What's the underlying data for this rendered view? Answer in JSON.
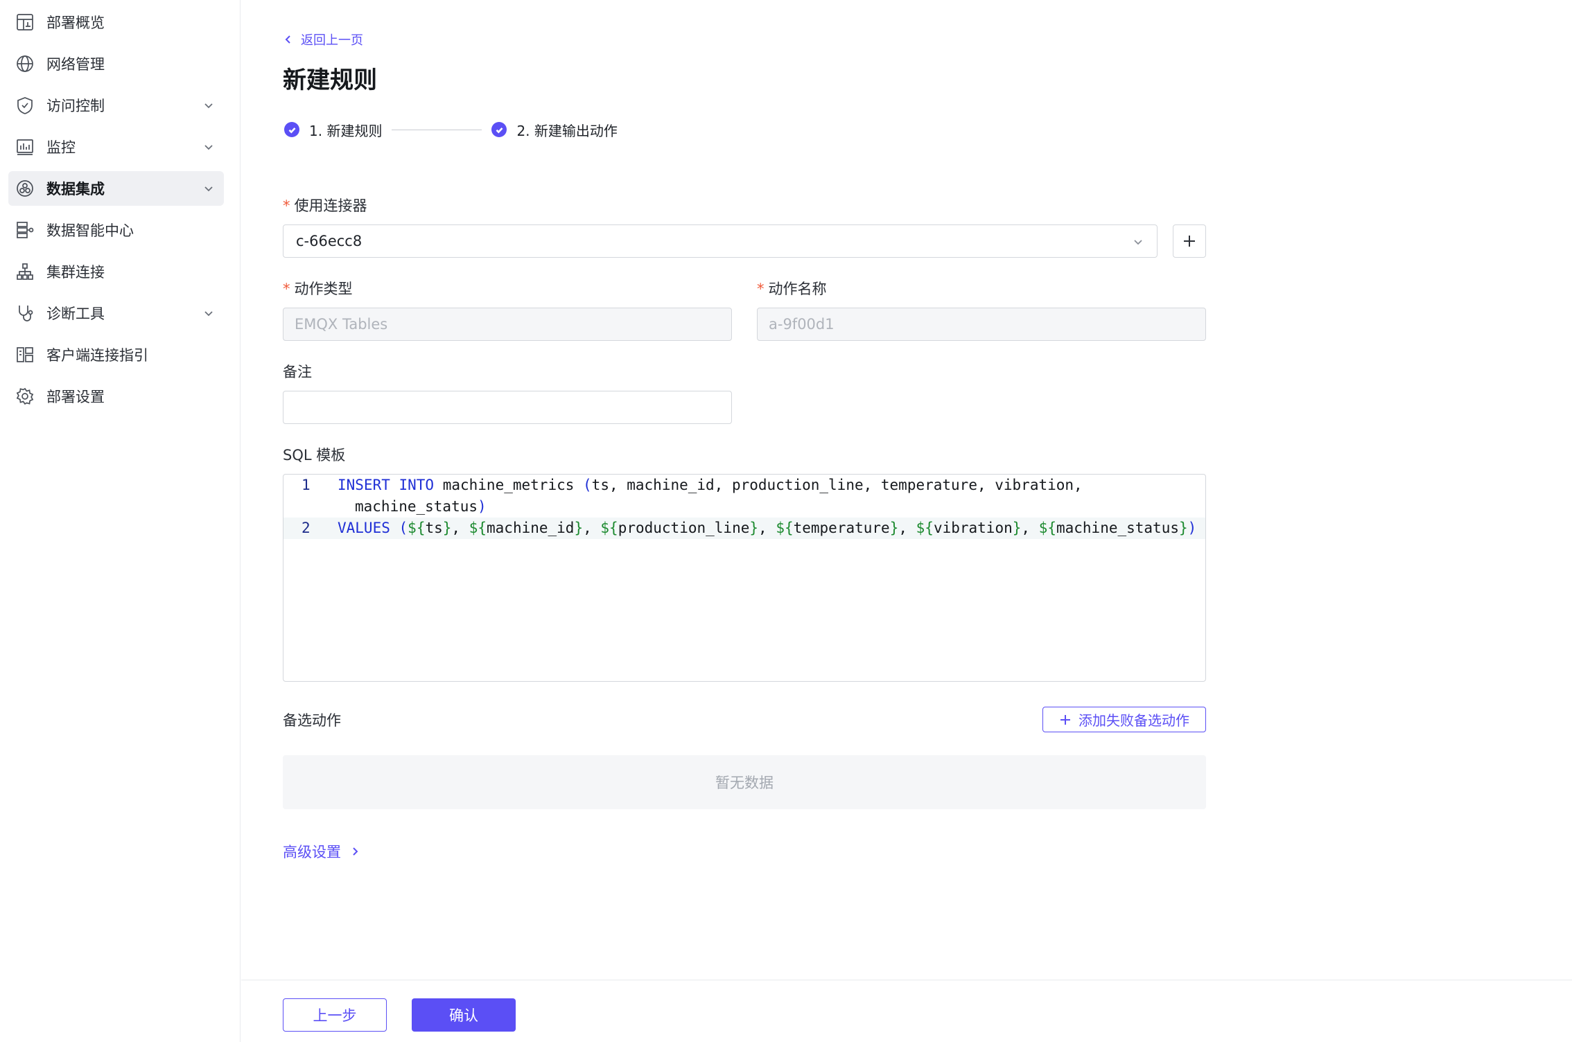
{
  "sidebar": {
    "items": [
      {
        "label": "部署概览",
        "icon": "dashboard-icon",
        "expandable": false
      },
      {
        "label": "网络管理",
        "icon": "globe-icon",
        "expandable": false
      },
      {
        "label": "访问控制",
        "icon": "shield-icon",
        "expandable": true
      },
      {
        "label": "监控",
        "icon": "chart-icon",
        "expandable": true
      },
      {
        "label": "数据集成",
        "icon": "integration-icon",
        "expandable": true,
        "active": true
      },
      {
        "label": "数据智能中心",
        "icon": "data-center-icon",
        "expandable": false
      },
      {
        "label": "集群连接",
        "icon": "cluster-icon",
        "expandable": false
      },
      {
        "label": "诊断工具",
        "icon": "stethoscope-icon",
        "expandable": true
      },
      {
        "label": "客户端连接指引",
        "icon": "client-guide-icon",
        "expandable": false
      },
      {
        "label": "部署设置",
        "icon": "gear-icon",
        "expandable": false
      }
    ]
  },
  "header": {
    "back_label": "返回上一页",
    "title": "新建规则"
  },
  "steps": [
    {
      "label": "1. 新建规则",
      "done": true
    },
    {
      "label": "2. 新建输出动作",
      "done": true
    }
  ],
  "form": {
    "connector_label": "使用连接器",
    "connector_value": "c-66ecc8",
    "action_type_label": "动作类型",
    "action_type_placeholder": "EMQX Tables",
    "action_name_label": "动作名称",
    "action_name_placeholder": "a-9f00d1",
    "note_label": "备注",
    "note_value": "",
    "sql_label": "SQL 模板"
  },
  "sql": {
    "line1_num": "1",
    "line2_num": "2",
    "l1_kw": "INSERT INTO",
    "l1_table": " machine_metrics ",
    "l1_open": "(",
    "l1_cols": "ts, machine_id, production_line, temperature, vibration,",
    "l1_wrap": "machine_status",
    "l1_close": ")",
    "l2_kw": "VALUES",
    "l2_open": "(",
    "l2_close": ")",
    "values": [
      "ts",
      "machine_id",
      "production_line",
      "temperature",
      "vibration",
      "machine_status"
    ]
  },
  "fallback": {
    "label": "备选动作",
    "add_button": "添加失败备选动作",
    "empty_text": "暂无数据"
  },
  "advanced_label": "高级设置",
  "footer": {
    "prev_label": "上一步",
    "confirm_label": "确认"
  },
  "colors": {
    "accent": "#5b4ff5",
    "required": "#f05a3a",
    "sql_keyword": "#1f2fd6",
    "sql_template": "#1c8a2f"
  }
}
